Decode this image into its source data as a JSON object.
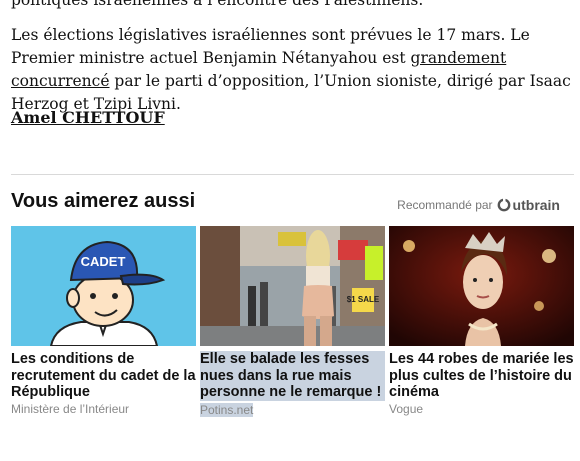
{
  "article": {
    "cut_line": "politiques israéliennes à l’encontre des Palestiniens.",
    "para_1": "Les élections législatives israéliennes sont prévues le 17 mars. Le Premier ministre actuel Benjamin Nétanyahou est ",
    "para_link": "grandement concurrencé",
    "para_2": " par le parti d’opposition, l’Union sioniste, dirigé par Isaac Herzog et Tzipi Livni.",
    "author": "Amel CHETTOUF"
  },
  "widget": {
    "title": "Vous aimerez aussi",
    "recommended_by": "Recommandé par",
    "logo_text": "utbrain",
    "cards": [
      {
        "headline": "Les conditions de recrutement du cadet de la République",
        "source": "Ministère de l’Intérieur",
        "cap_text": "CADET",
        "icon": "cadet-cartoon-image"
      },
      {
        "headline": "Elle se balade les fesses nues dans la rue mais personne ne le remarque !",
        "source": "Potins.net",
        "sign_text": "$1 SALE",
        "icon": "street-photo-image"
      },
      {
        "headline": "Les 44 robes de mariée les plus cultes de l’histoire du cinéma",
        "source": "Vogue",
        "icon": "actress-photo-image"
      }
    ]
  }
}
